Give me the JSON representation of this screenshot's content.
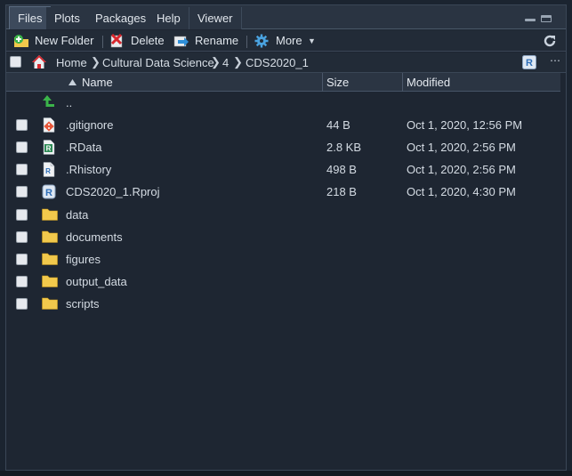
{
  "tabs": [
    {
      "label": "Files",
      "active": true
    },
    {
      "label": "Plots",
      "active": false
    },
    {
      "label": "Packages",
      "active": false
    },
    {
      "label": "Help",
      "active": false
    },
    {
      "label": "Viewer",
      "active": false
    }
  ],
  "toolbar": {
    "new_folder": "New Folder",
    "delete": "Delete",
    "rename": "Rename",
    "more": "More"
  },
  "breadcrumb": {
    "home": "Home",
    "parts": [
      "Cultural Data Science",
      "4",
      "CDS2020_1"
    ]
  },
  "columns": {
    "name": "Name",
    "size": "Size",
    "modified": "Modified"
  },
  "parent_dir": "..",
  "files": [
    {
      "name": ".gitignore",
      "size": "44 B",
      "modified": "Oct 1, 2020, 12:56 PM",
      "icon": "git-file-icon"
    },
    {
      "name": ".RData",
      "size": "2.8 KB",
      "modified": "Oct 1, 2020, 2:56 PM",
      "icon": "rdata-file-icon"
    },
    {
      "name": ".Rhistory",
      "size": "498 B",
      "modified": "Oct 1, 2020, 2:56 PM",
      "icon": "rhistory-file-icon"
    },
    {
      "name": "CDS2020_1.Rproj",
      "size": "218 B",
      "modified": "Oct 1, 2020, 4:30 PM",
      "icon": "rproj-file-icon"
    },
    {
      "name": "data",
      "size": "",
      "modified": "",
      "icon": "folder-icon"
    },
    {
      "name": "documents",
      "size": "",
      "modified": "",
      "icon": "folder-icon"
    },
    {
      "name": "figures",
      "size": "",
      "modified": "",
      "icon": "folder-icon"
    },
    {
      "name": "output_data",
      "size": "",
      "modified": "",
      "icon": "folder-icon"
    },
    {
      "name": "scripts",
      "size": "",
      "modified": "",
      "icon": "folder-icon"
    }
  ],
  "colors": {
    "background": "#1e2632",
    "header": "#2b3543",
    "accent_blue": "#4aa3e0",
    "folder_yellow": "#f2c94c"
  }
}
